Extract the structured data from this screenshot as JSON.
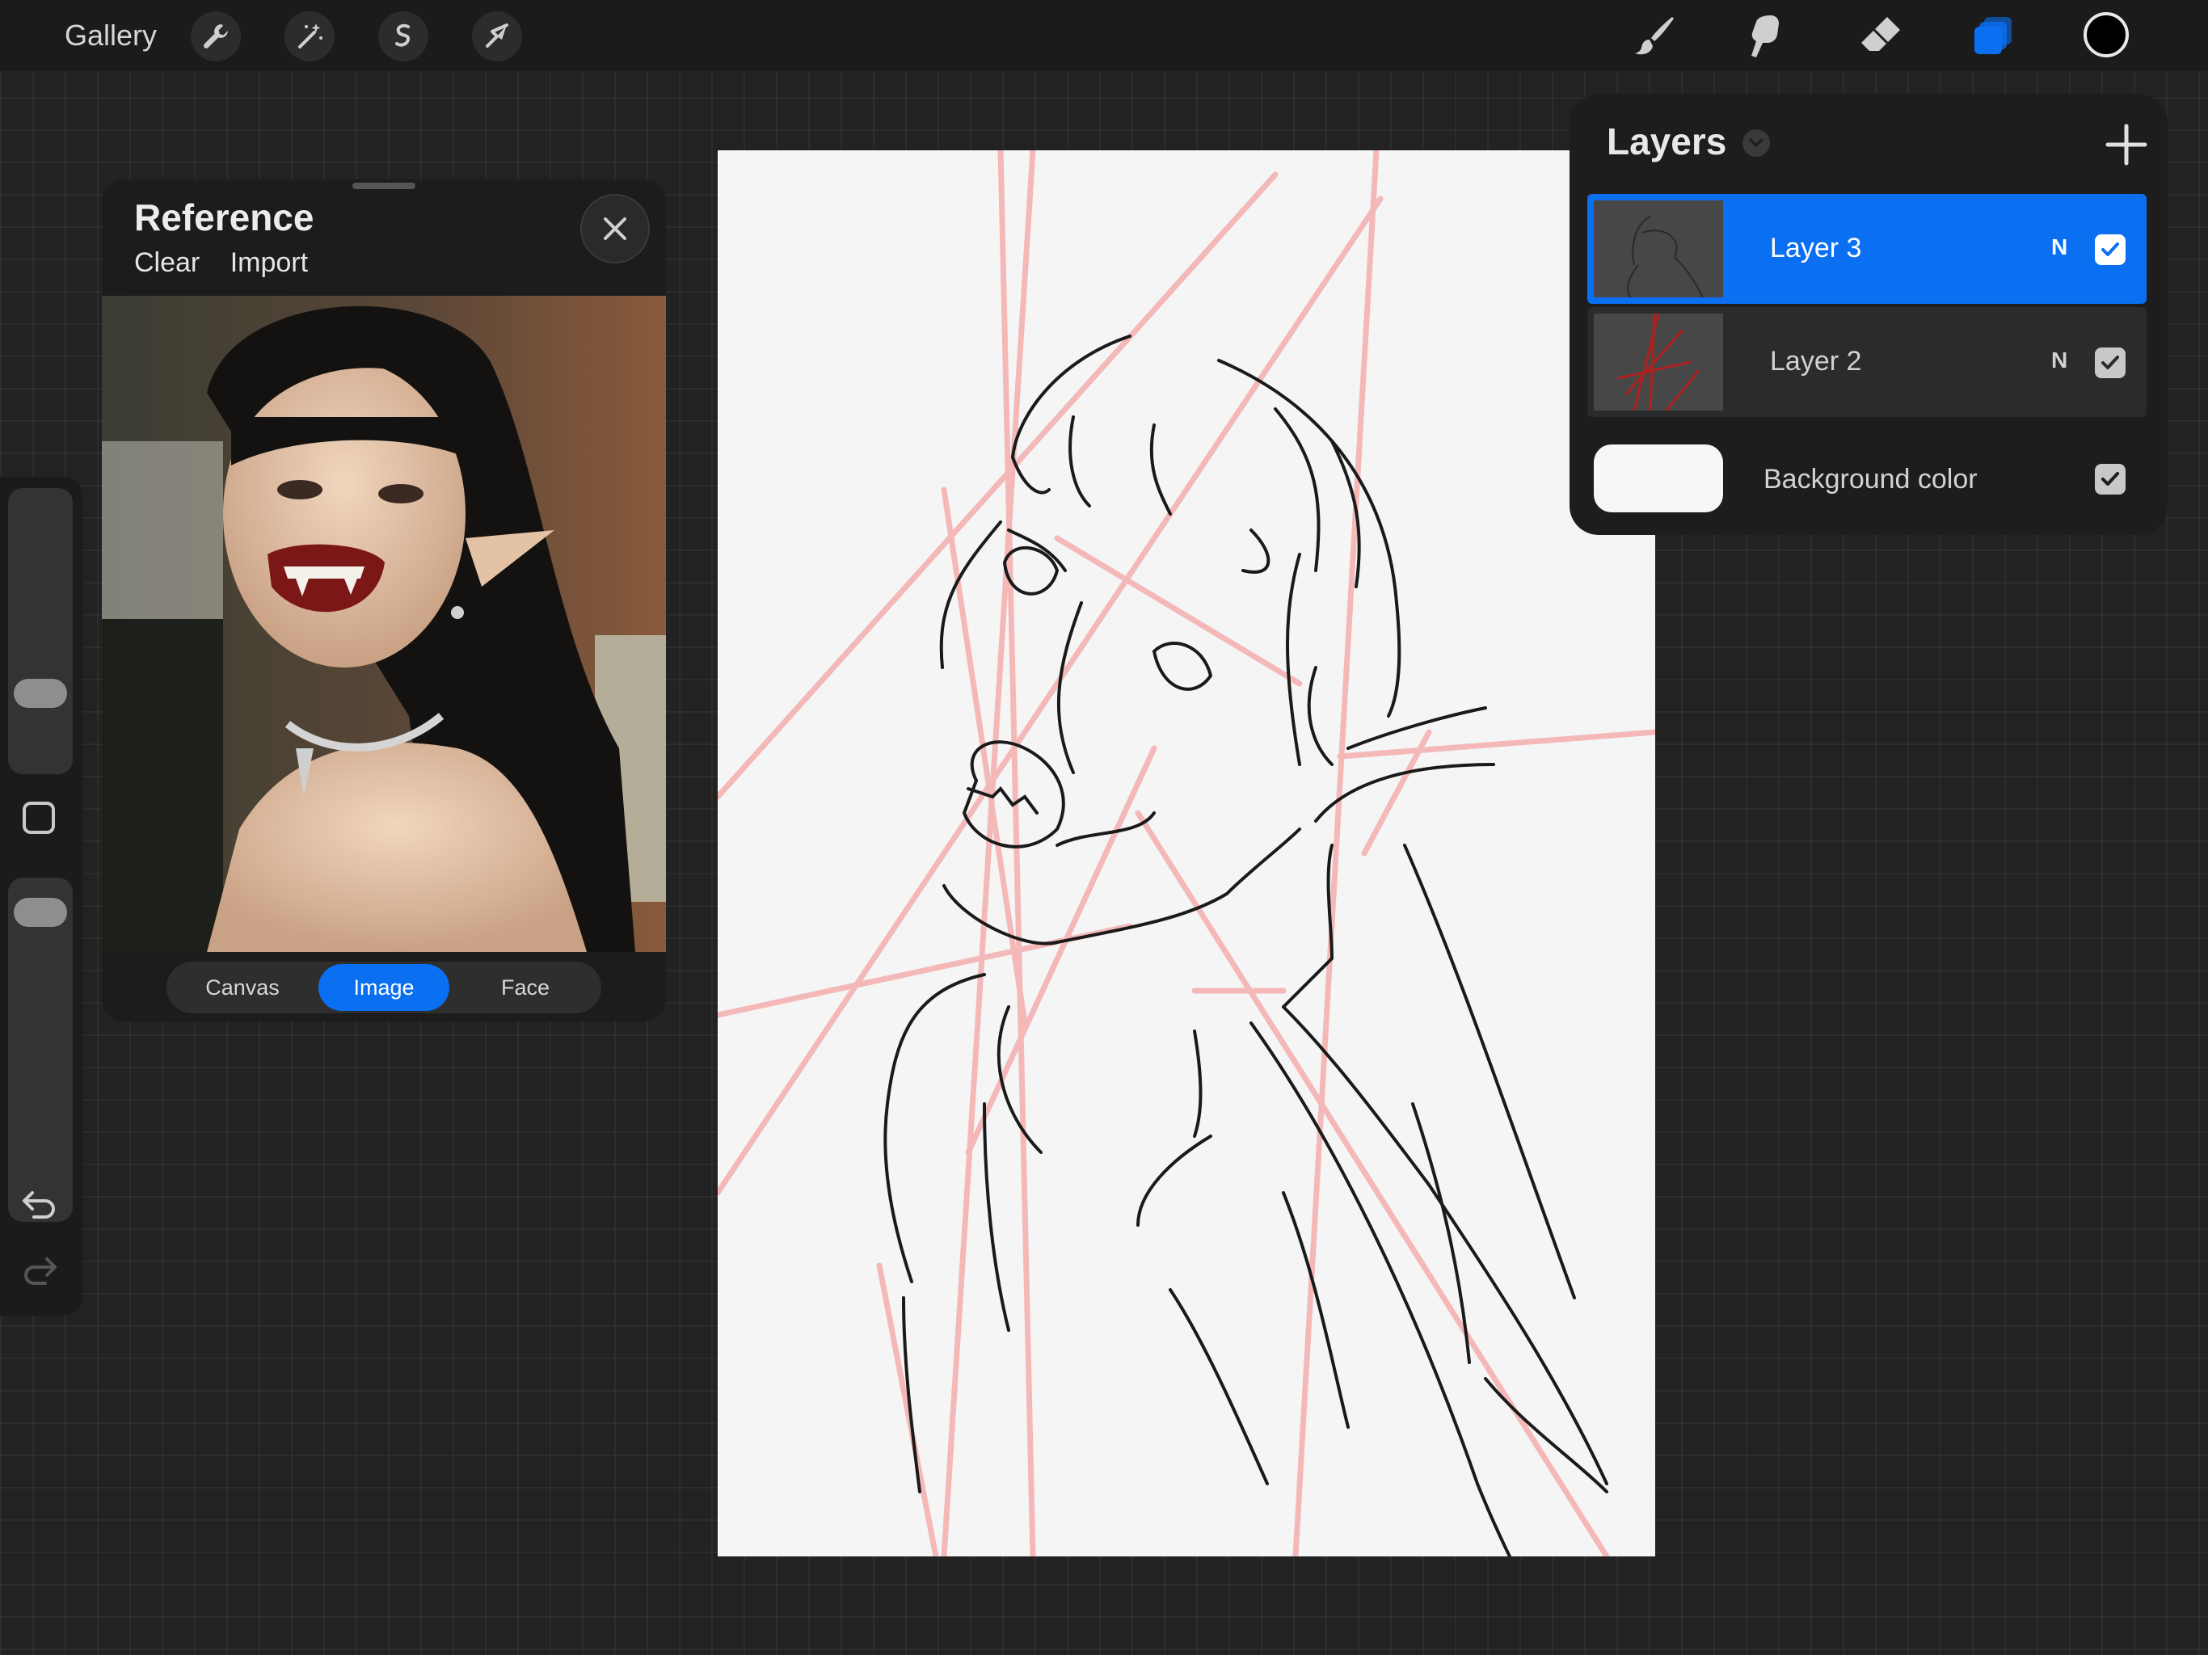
{
  "toolbar": {
    "gallery_label": "Gallery",
    "left_tools": [
      "wrench-icon",
      "magic-wand-icon",
      "selection-icon",
      "transform-arrow-icon"
    ],
    "right_tools": [
      "brush-icon",
      "smudge-icon",
      "eraser-icon",
      "layers-icon"
    ],
    "accent": "#0a6ff1",
    "current_color": "#000000"
  },
  "sidebar": {
    "brush_size_level": 0.25,
    "opacity_level": 0.05,
    "icons": [
      "modify-square-icon",
      "undo-icon",
      "redo-icon"
    ]
  },
  "reference": {
    "title": "Reference",
    "clear_label": "Clear",
    "import_label": "Import",
    "tabs": [
      {
        "label": "Canvas",
        "active": false
      },
      {
        "label": "Image",
        "active": true
      },
      {
        "label": "Face",
        "active": false
      }
    ]
  },
  "layers": {
    "title": "Layers",
    "items": [
      {
        "name": "Layer 3",
        "mode": "N",
        "visible": true,
        "selected": true
      },
      {
        "name": "Layer 2",
        "mode": "N",
        "visible": true,
        "selected": false
      }
    ],
    "background": {
      "label": "Background color",
      "visible": true,
      "color": "#f7f7f7"
    }
  }
}
